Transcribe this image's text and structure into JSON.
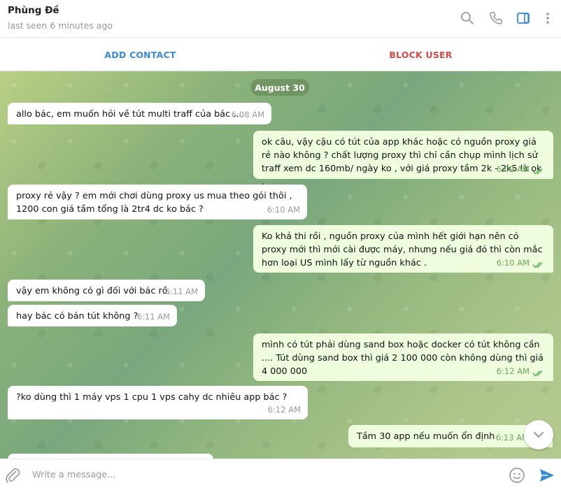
{
  "header": {
    "contact_name": "Phùng Đề",
    "last_seen": "last seen 6 minutes ago",
    "icons": [
      "search-icon",
      "phone-icon",
      "sidebar-toggle-icon",
      "more-vertical-icon"
    ]
  },
  "actions": {
    "add_contact": "ADD CONTACT",
    "block_user": "BLOCK USER"
  },
  "chat": {
    "date": "August 30",
    "messages": [
      {
        "dir": "in",
        "text": "allo bác, em muốn hỏi về tút multi traff của bác ....",
        "time": "6:08 AM"
      },
      {
        "dir": "out",
        "text": "ok câu, vậy cậu có tút của app khác hoặc có nguồn proxy giả rẻ nào không ? chất lượng proxy thì chỉ cần chụp mình lịch sử traff xem dc 160mb/ ngày ko , với giá  proxy tầm 2k - 2k5 là ok .",
        "time": "6:09 AM",
        "read": true
      },
      {
        "dir": "in",
        "text": "proxy rẻ vậy ? em mới chơi dùng proxy us mua theo gói thôi , 1200 con giá tầm tổng là 2tr4 dc ko bác ?",
        "time": "6:10 AM"
      },
      {
        "dir": "out",
        "text": "Ko khả thi rồi , nguồn proxy của mình hết giới hạn nên có proxy mới thì mới cài được máy, nhưng nếu giá đó thì còn mắc hơn loại US mình lấy từ nguồn khác .",
        "time": "6:10 AM",
        "read": true
      },
      {
        "dir": "in",
        "text": "vậy em không có gì đối với bác rồ.",
        "time": "6:11 AM"
      },
      {
        "dir": "in",
        "text": "hay bác có bán tút không ?",
        "time": "6:11 AM"
      },
      {
        "dir": "out",
        "text": "mình có tút phải dùng sand box hoặc docker có tút không cần .... Tút dùng sand box thì giá 2 100 000 còn không dùng thì giá 4 000 000",
        "time": "6:12 AM",
        "read": true
      },
      {
        "dir": "in",
        "text": "?ko dùng thì 1 máy vps 1 cpu 1 vps cahy dc nhiêu app bác ?",
        "time": "6:12 AM"
      },
      {
        "dir": "out",
        "text": "Tầm 30  app nếu muốn ổn định",
        "time": "6:13 AM",
        "read": true
      }
    ]
  },
  "composer": {
    "placeholder": "Write a message...",
    "icons": [
      "attach-icon",
      "emoji-icon",
      "send-icon"
    ]
  },
  "colors": {
    "accent": "#3a8ad0",
    "danger": "#d14b4b",
    "outgoing_bubble": "#effdde",
    "read_check": "#5fb25a"
  }
}
